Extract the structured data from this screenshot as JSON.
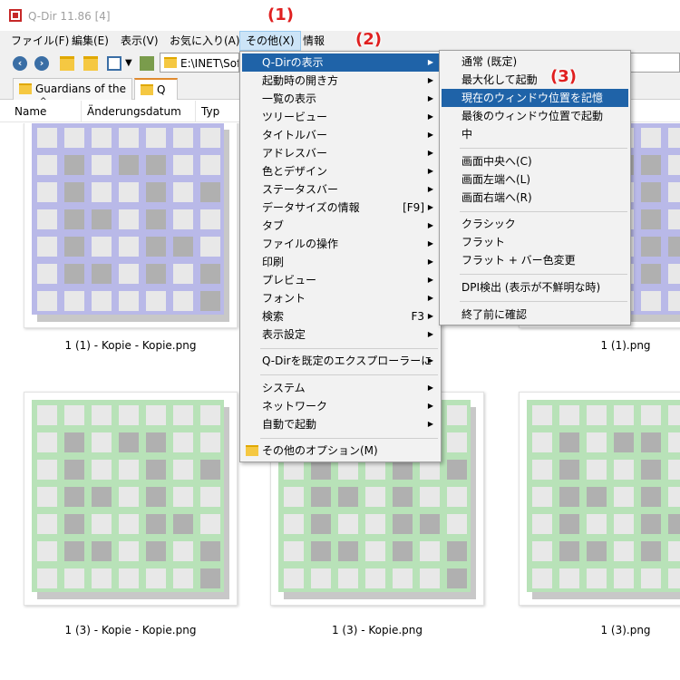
{
  "window": {
    "title": "Q-Dir 11.86 [4]"
  },
  "menubar": {
    "items": [
      {
        "label": "ファイル(F)"
      },
      {
        "label": "編集(E)"
      },
      {
        "label": "表示(V)"
      },
      {
        "label": "お気に入り(A)"
      },
      {
        "label": "その他(X)"
      },
      {
        "label": "情報"
      }
    ]
  },
  "toolbar": {
    "address": "E:\\INET\\Soft"
  },
  "tabs": [
    {
      "label": "Guardians of the ..."
    },
    {
      "label": "Q"
    }
  ],
  "columns": [
    {
      "label": "Name"
    },
    {
      "label": "Änderungsdatum"
    },
    {
      "label": "Typ"
    }
  ],
  "files": [
    {
      "caption": "1 (1) - Kopie - Kopie.png",
      "color": "#b9b9e8"
    },
    {
      "caption": "1 (1).png",
      "color": "#b9b9e8"
    },
    {
      "caption": "1 (3) - Kopie - Kopie.png",
      "color": "#b8e2b8"
    },
    {
      "caption": "1 (3) - Kopie.png",
      "color": "#b8e2b8"
    },
    {
      "caption": "1 (3).png",
      "color": "#b8e2b8"
    }
  ],
  "main_menu": {
    "items": [
      {
        "label": "Q-Dirの表示",
        "arrow": "▶"
      },
      {
        "label": "起動時の開き方",
        "arrow": "▶"
      },
      {
        "label": "一覧の表示",
        "arrow": "▶"
      },
      {
        "label": "ツリービュー",
        "arrow": "▶"
      },
      {
        "label": "タイトルバー",
        "arrow": "▶"
      },
      {
        "label": "アドレスバー",
        "arrow": "▶"
      },
      {
        "label": "色とデザイン",
        "arrow": "▶"
      },
      {
        "label": "ステータスバー",
        "arrow": "▶"
      },
      {
        "label": "データサイズの情報",
        "shortcut": "[F9]",
        "arrow": "▶"
      },
      {
        "label": "タブ",
        "arrow": "▶"
      },
      {
        "label": "ファイルの操作",
        "arrow": "▶"
      },
      {
        "label": "印刷",
        "arrow": "▶"
      },
      {
        "label": "プレビュー",
        "arrow": "▶"
      },
      {
        "label": "フォント",
        "arrow": "▶"
      },
      {
        "label": "検索",
        "shortcut": "F3",
        "arrow": "▶"
      },
      {
        "label": "表示設定",
        "arrow": "▶"
      },
      {
        "label": "Q-Dirを既定のエクスプローラーに",
        "arrow": "▶"
      },
      {
        "label": "システム",
        "arrow": "▶"
      },
      {
        "label": "ネットワーク",
        "arrow": "▶"
      },
      {
        "label": "自動で起動",
        "arrow": "▶"
      },
      {
        "label": "その他のオプション(M)"
      }
    ]
  },
  "sub_menu": {
    "items": [
      {
        "label": "通常 (既定)"
      },
      {
        "label": "最大化して起動"
      },
      {
        "label": "現在のウィンドウ位置を記憶"
      },
      {
        "label": "最後のウィンドウ位置で起動"
      },
      {
        "label": "中"
      },
      {
        "label": "画面中央へ(C)"
      },
      {
        "label": "画面左端へ(L)"
      },
      {
        "label": "画面右端へ(R)"
      },
      {
        "label": "クラシック"
      },
      {
        "label": "フラット"
      },
      {
        "label": "フラット + バー色変更"
      },
      {
        "label": "DPI検出 (表示が不鮮明な時)"
      },
      {
        "label": "終了前に確認"
      }
    ]
  },
  "callouts": [
    "(1)",
    "(2)",
    "(3)"
  ],
  "colors": {
    "highlight": "#1f63a8",
    "callout": "#e02020"
  }
}
